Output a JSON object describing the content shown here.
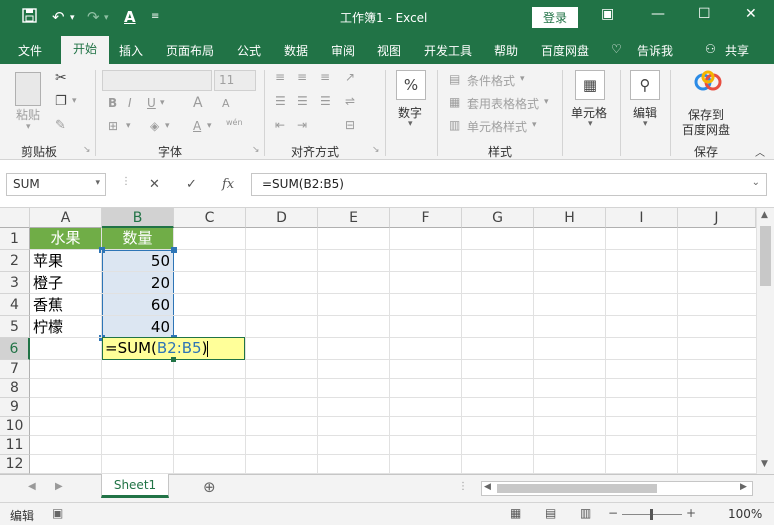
{
  "titlebar": {
    "title": "工作簿1 - Excel",
    "login_label": "登录",
    "save_icon": "save-icon",
    "undo_icon": "undo-icon",
    "redo_icon": "redo-icon",
    "font_color_icon": "font-color-icon",
    "customize_icon": "customize-icon"
  },
  "ribbon_tabs": [
    "文件",
    "开始",
    "插入",
    "页面布局",
    "公式",
    "数据",
    "审阅",
    "视图",
    "开发工具",
    "帮助",
    "百度网盘",
    "告诉我",
    "共享"
  ],
  "ribbon": {
    "clipboard": {
      "paste": "粘贴",
      "group": "剪贴板"
    },
    "font": {
      "size": "11",
      "bold": "B",
      "italic": "I",
      "underline": "U",
      "increase": "A",
      "decrease": "A",
      "phonetic": "wén",
      "group": "字体"
    },
    "alignment": {
      "group": "对齐方式"
    },
    "number": {
      "symbol": "%",
      "label": "数字"
    },
    "styles": {
      "conditional": "条件格式",
      "table": "套用表格格式",
      "cell": "单元格样式",
      "group": "样式"
    },
    "cells": {
      "label": "单元格"
    },
    "editing": {
      "label": "编辑"
    },
    "save": {
      "line1": "保存到",
      "line2": "百度网盘",
      "group": "保存"
    }
  },
  "formula_bar": {
    "name_box": "SUM",
    "cancel": "✕",
    "enter": "✓",
    "fx": "fx",
    "formula": "=SUM(B2:B5)"
  },
  "columns": [
    "A",
    "B",
    "C",
    "D",
    "E",
    "F",
    "G",
    "H",
    "I",
    "J"
  ],
  "rows": [
    "1",
    "2",
    "3",
    "4",
    "5",
    "6",
    "7",
    "8",
    "9",
    "10",
    "11",
    "12"
  ],
  "cells": {
    "A1": "水果",
    "B1": "数量",
    "A2": "苹果",
    "B2": "50",
    "A3": "橙子",
    "B3": "20",
    "A4": "香蕉",
    "B4": "60",
    "A5": "柠檬",
    "B5": "40",
    "B6_prefix": "=SUM(",
    "B6_ref": "B2:B5",
    "B6_suffix": ")"
  },
  "colors": {
    "excel_green": "#217346",
    "header_fill": "#70ad47",
    "range_highlight": "#dce6f2",
    "ref_blue": "#2e75b6",
    "formula_cell": "#ffff99"
  },
  "sheet_tabs": [
    "Sheet1"
  ],
  "status": {
    "mode": "编辑",
    "zoom": "100%"
  }
}
